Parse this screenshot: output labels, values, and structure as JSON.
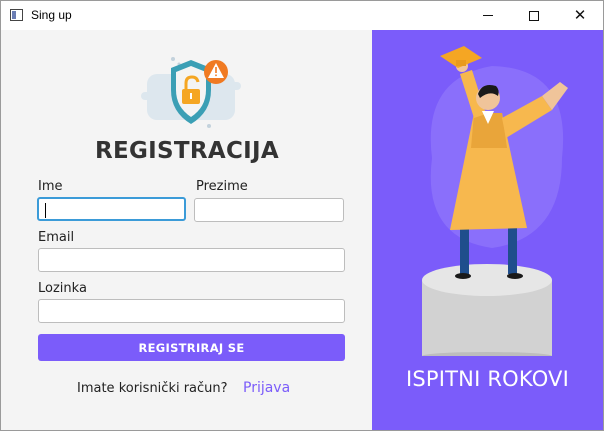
{
  "window": {
    "title": "Sing up",
    "minimize_label": "minimize",
    "maximize_label": "maximize",
    "close_label": "close"
  },
  "form": {
    "heading": "REGISTRACIJA",
    "first_name": {
      "label": "Ime",
      "value": ""
    },
    "last_name": {
      "label": "Prezime",
      "value": ""
    },
    "email": {
      "label": "Email",
      "value": ""
    },
    "password": {
      "label": "Lozinka",
      "value": ""
    },
    "submit_label": "REGISTRIRAJ SE",
    "account_question": "Imate korisnički račun?",
    "login_link": "Prijava"
  },
  "side_panel": {
    "title": "ISPITNI ROKOVI"
  },
  "colors": {
    "accent": "#7b5cfa",
    "focus": "#3b9bd8",
    "gown": "#f7b84e",
    "shield": "#3b9fb5",
    "lock": "#f5a623",
    "warning": "#f07a22"
  },
  "icons": [
    "security-shield-icon",
    "warning-icon",
    "unlock-icon",
    "graduate-illustration"
  ]
}
